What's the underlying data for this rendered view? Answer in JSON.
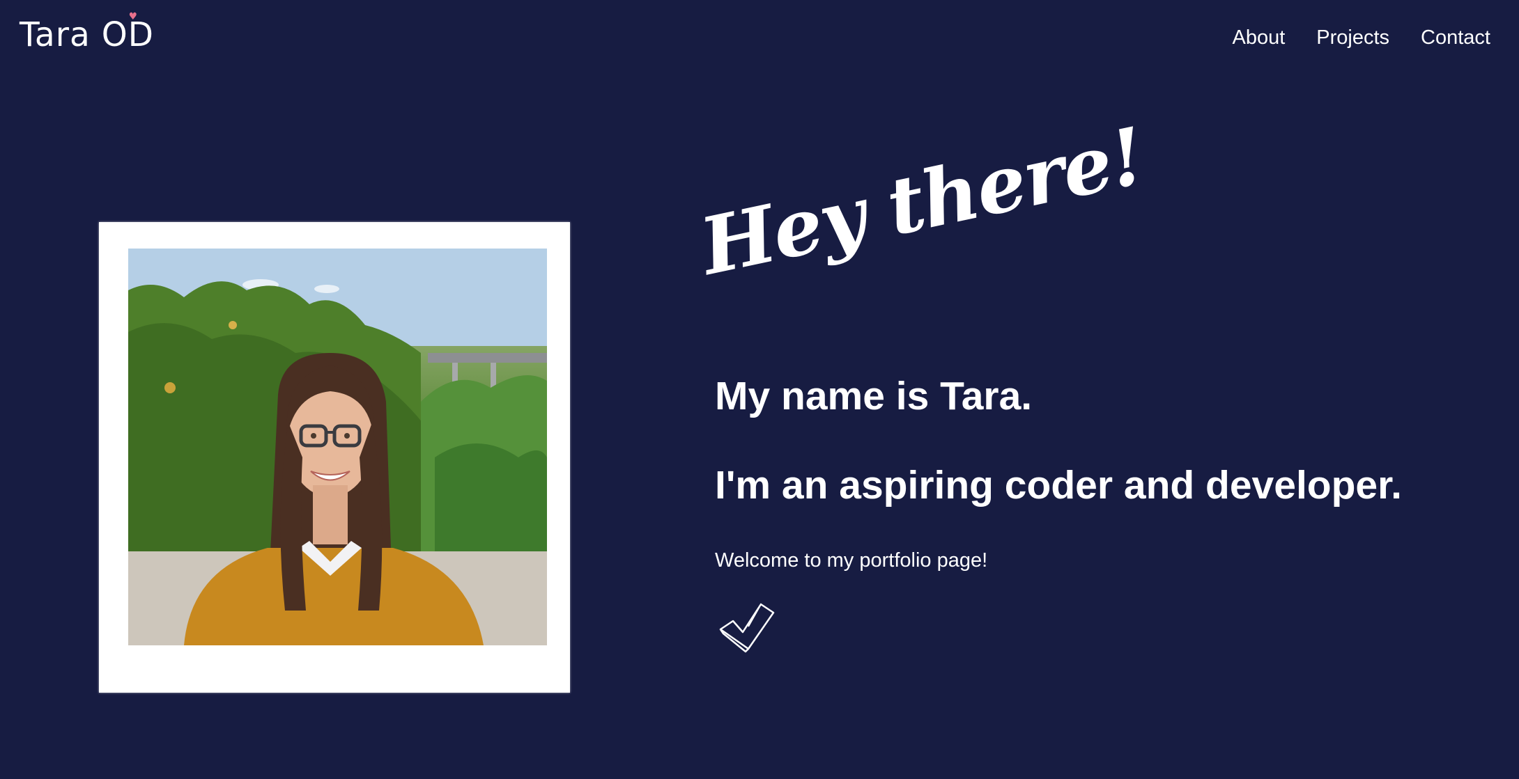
{
  "header": {
    "logo_text": "Tara OD",
    "nav": [
      {
        "label": "About"
      },
      {
        "label": "Projects"
      },
      {
        "label": "Contact"
      }
    ]
  },
  "hero": {
    "greeting": "Hey there!",
    "name_line": "My name is Tara.",
    "role_line": "I'm an aspiring coder and developer.",
    "welcome_line": "Welcome to my portfolio page!",
    "check_icon": "checkmark-icon"
  },
  "colors": {
    "background": "#171c42",
    "text": "#ffffff",
    "logo_heart": "#e9708c",
    "sweater": "#c8891f"
  }
}
